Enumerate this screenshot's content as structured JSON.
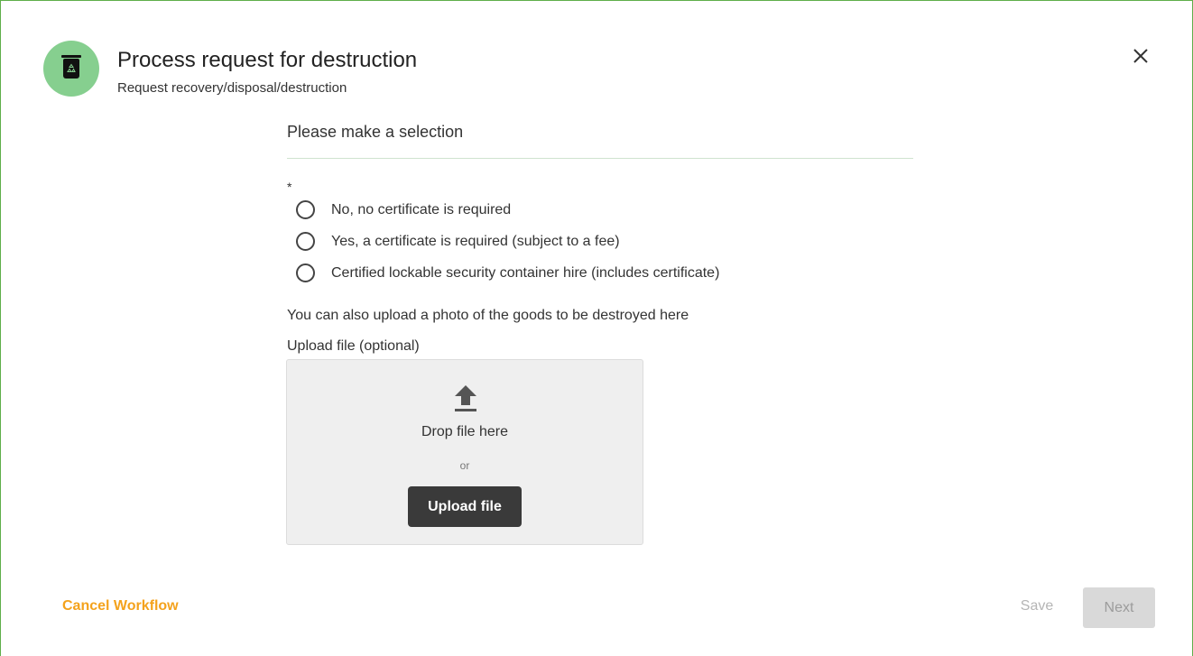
{
  "header": {
    "icon": "recycle-bin-icon",
    "title": "Process request for destruction",
    "subtitle": "Request recovery/disposal/destruction",
    "close_icon": "close-icon"
  },
  "form": {
    "section_heading": "Please make a selection",
    "required_marker": "*",
    "options": [
      {
        "label": "No, no certificate is required",
        "selected": false
      },
      {
        "label": "Yes, a certificate is required (subject to a fee)",
        "selected": false
      },
      {
        "label": "Certified lockable security container hire (includes certificate)",
        "selected": false
      }
    ],
    "info_text": "You can also upload a photo of the goods to be destroyed here",
    "upload_label": "Upload file (optional)",
    "dropzone": {
      "icon": "upload-icon",
      "drop_text": "Drop file here",
      "or_text": "or",
      "button_label": "Upload file"
    }
  },
  "footer": {
    "cancel_label": "Cancel Workflow",
    "save_label": "Save",
    "next_label": "Next"
  },
  "colors": {
    "accent_green": "#86cf8f",
    "border_green": "#5fae4a",
    "cancel_orange": "#f4a21c",
    "upload_button": "#3a3a3a"
  }
}
